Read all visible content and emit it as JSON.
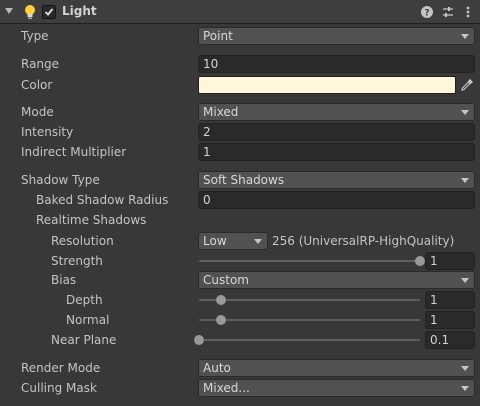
{
  "header": {
    "title": "Light",
    "enabled": true,
    "icons": [
      "light-bulb-icon",
      "help-icon",
      "presets-icon",
      "more-icon"
    ]
  },
  "rows": {
    "type": {
      "label": "Type",
      "value": "Point"
    },
    "range": {
      "label": "Range",
      "value": "10"
    },
    "color": {
      "label": "Color",
      "value": "#FFF6DC"
    },
    "mode": {
      "label": "Mode",
      "value": "Mixed"
    },
    "intensity": {
      "label": "Intensity",
      "value": "2"
    },
    "indirect": {
      "label": "Indirect Multiplier",
      "value": "1"
    },
    "shadow_type": {
      "label": "Shadow Type",
      "value": "Soft Shadows"
    },
    "baked_radius": {
      "label": "Baked Shadow Radius",
      "value": "0"
    },
    "realtime_shadows": {
      "label": "Realtime Shadows"
    },
    "resolution": {
      "label": "Resolution",
      "value": "Low",
      "info": "256 (UniversalRP-HighQuality)"
    },
    "strength": {
      "label": "Strength",
      "value": "1",
      "level": 1.0
    },
    "bias": {
      "label": "Bias",
      "value": "Custom"
    },
    "depth": {
      "label": "Depth",
      "value": "1",
      "level": 0.1
    },
    "normal": {
      "label": "Normal",
      "value": "1",
      "level": 0.1
    },
    "near_plane": {
      "label": "Near Plane",
      "value": "0.1",
      "level": 0.0
    },
    "render_mode": {
      "label": "Render Mode",
      "value": "Auto"
    },
    "culling_mask": {
      "label": "Culling Mask",
      "value": "Mixed..."
    }
  }
}
